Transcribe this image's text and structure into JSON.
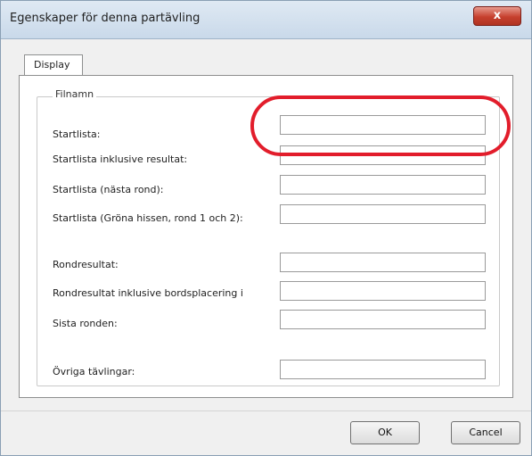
{
  "window": {
    "title": "Egenskaper för denna partävling",
    "close_label": "x"
  },
  "tabs": [
    {
      "label": "Display"
    }
  ],
  "groupbox": {
    "title": "Filnamn"
  },
  "rows": [
    {
      "label": "Startlista:",
      "value": ""
    },
    {
      "label": "Startlista inklusive resultat:",
      "value": ""
    },
    {
      "label": "Startlista (nästa rond):",
      "value": ""
    },
    {
      "label": "Startlista (Gröna hissen, rond 1 och 2):",
      "value": ""
    },
    {
      "label": "Rondresultat:",
      "value": ""
    },
    {
      "label": "Rondresultat inklusive bordsplacering i",
      "value": ""
    },
    {
      "label": "Sista ronden:",
      "value": ""
    },
    {
      "label": "Övriga tävlingar:",
      "value": ""
    }
  ],
  "buttons": {
    "ok": "OK",
    "cancel": "Cancel"
  },
  "colors": {
    "highlight": "#e21d2b"
  }
}
